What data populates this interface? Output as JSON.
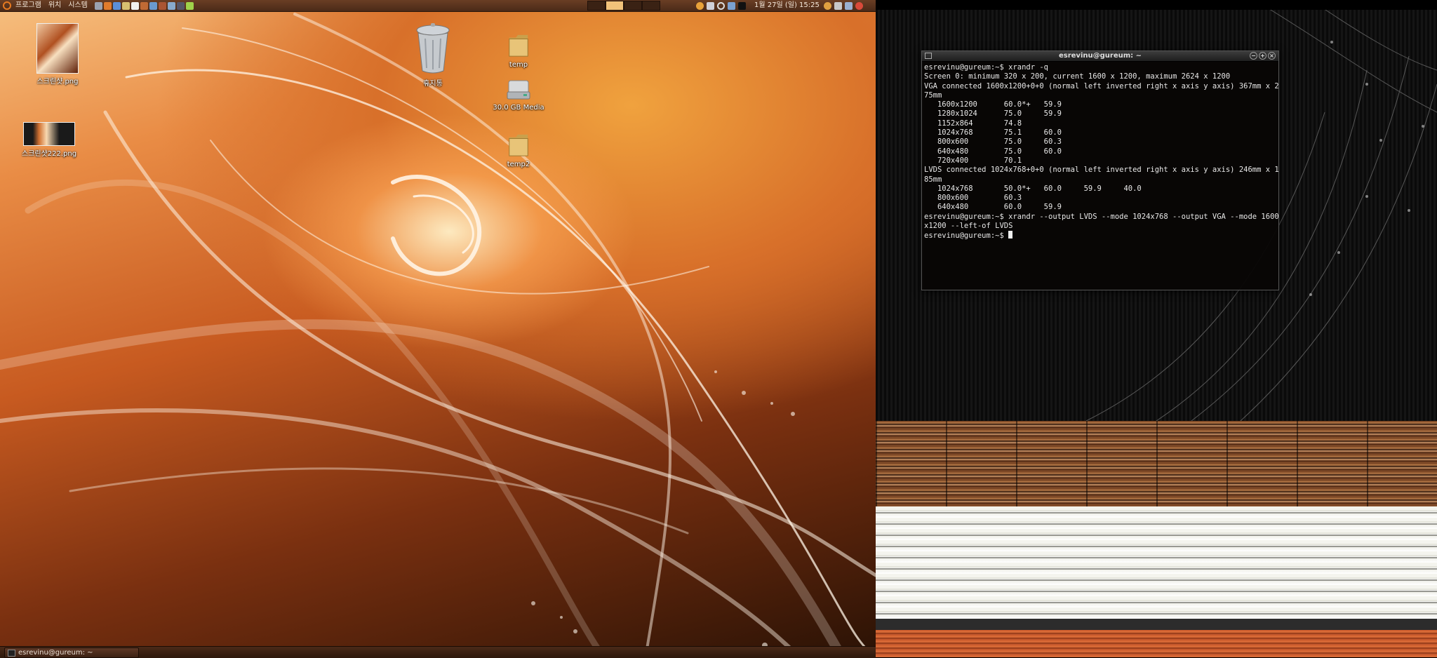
{
  "top_panel": {
    "menus": [
      {
        "label": "프로그램"
      },
      {
        "label": "위치"
      },
      {
        "label": "시스템"
      }
    ],
    "launchers": [
      {
        "icon": "terminal-launcher-icon",
        "color": "#9aa2b0"
      },
      {
        "icon": "web-browser-icon",
        "color": "#e07b2c"
      },
      {
        "icon": "mail-icon",
        "color": "#5b8fd8"
      },
      {
        "icon": "file-manager-icon",
        "color": "#d8c070"
      },
      {
        "icon": "text-editor-icon",
        "color": "#f0f0f0"
      },
      {
        "icon": "audio-icon",
        "color": "#c06a34"
      },
      {
        "icon": "media-player-icon",
        "color": "#6a9ad0"
      },
      {
        "icon": "photo-icon",
        "color": "#aa5533"
      },
      {
        "icon": "chat-icon",
        "color": "#88aacc"
      },
      {
        "icon": "monitor-icon",
        "color": "#555566"
      },
      {
        "icon": "update-icon",
        "color": "#9fd24a"
      }
    ],
    "clock": "1월 27일 (일) 15:25"
  },
  "bottom_panel": {
    "task_label": "esrevinu@gureum: ~"
  },
  "desktop_icons": {
    "screenshot1": "스크린샷.png",
    "screenshot2": "스크린샷222.png",
    "trash": "휴지통",
    "temp": "temp",
    "media": "30.0 GB Media",
    "temp2": "temp2"
  },
  "terminal": {
    "title": "esrevinu@gureum: ~",
    "lines": [
      "esrevinu@gureum:~$ xrandr -q",
      "Screen 0: minimum 320 x 200, current 1600 x 1200, maximum 2624 x 1200",
      "VGA connected 1600x1200+0+0 (normal left inverted right x axis y axis) 367mm x 2",
      "75mm",
      "   1600x1200      60.0*+   59.9",
      "   1280x1024      75.0     59.9",
      "   1152x864       74.8",
      "   1024x768       75.1     60.0",
      "   800x600        75.0     60.3",
      "   640x480        75.0     60.0",
      "   720x400        70.1",
      "LVDS connected 1024x768+0+0 (normal left inverted right x axis y axis) 246mm x 1",
      "85mm",
      "   1024x768       50.0*+   60.0     59.9     40.0",
      "   800x600        60.3",
      "   640x480        60.0     59.9",
      "esrevinu@gureum:~$ xrandr --output LVDS --mode 1024x768 --output VGA --mode 1600",
      "x1200 --left-of LVDS",
      "esrevinu@gureum:~$ "
    ]
  },
  "colors": {
    "panel": "#5a341e",
    "accent": "#e87a20",
    "terminal_bg": "#080605"
  }
}
